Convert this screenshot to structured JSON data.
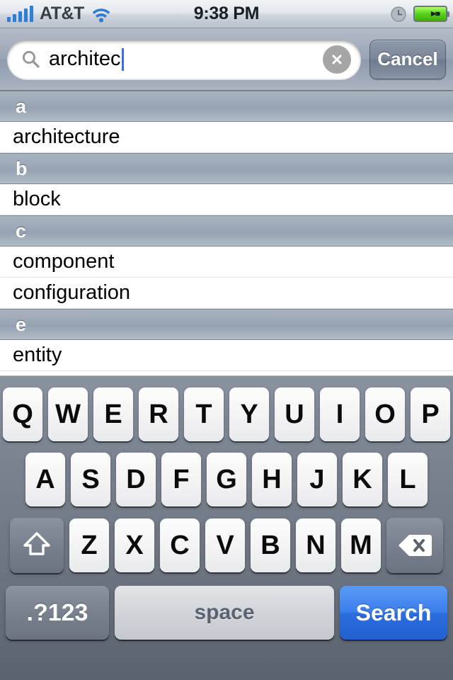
{
  "status_bar": {
    "carrier": "AT&T",
    "time": "9:38 PM",
    "signal_bars": 5,
    "icons": {
      "signal": "signal-bars-icon",
      "wifi": "wifi-icon",
      "clock": "clock-icon",
      "battery": "battery-charging-icon"
    },
    "colors": {
      "signal": "#2c7fd4",
      "wifi": "#2c7fd4",
      "battery_fill": "#58d41b"
    }
  },
  "search": {
    "value": "architec",
    "placeholder": "Search",
    "magnifier_icon": "search-icon",
    "clear_icon": "clear-circle-icon",
    "cancel_label": "Cancel",
    "caret_color": "#3e6fe2"
  },
  "list": {
    "sections": [
      {
        "header": "a",
        "rows": [
          "architecture"
        ]
      },
      {
        "header": "b",
        "rows": [
          "block"
        ]
      },
      {
        "header": "c",
        "rows": [
          "component",
          "configuration"
        ]
      },
      {
        "header": "e",
        "rows": [
          "entity"
        ]
      }
    ]
  },
  "keyboard": {
    "row1": [
      "Q",
      "W",
      "E",
      "R",
      "T",
      "Y",
      "U",
      "I",
      "O",
      "P"
    ],
    "row2": [
      "A",
      "S",
      "D",
      "F",
      "G",
      "H",
      "J",
      "K",
      "L"
    ],
    "row3": [
      "Z",
      "X",
      "C",
      "V",
      "B",
      "N",
      "M"
    ],
    "shift_icon": "shift-arrow-icon",
    "backspace_icon": "backspace-icon",
    "numbers_label": ".?123",
    "space_label": "space",
    "search_label": "Search",
    "search_key_color": "#2a6ddf"
  }
}
